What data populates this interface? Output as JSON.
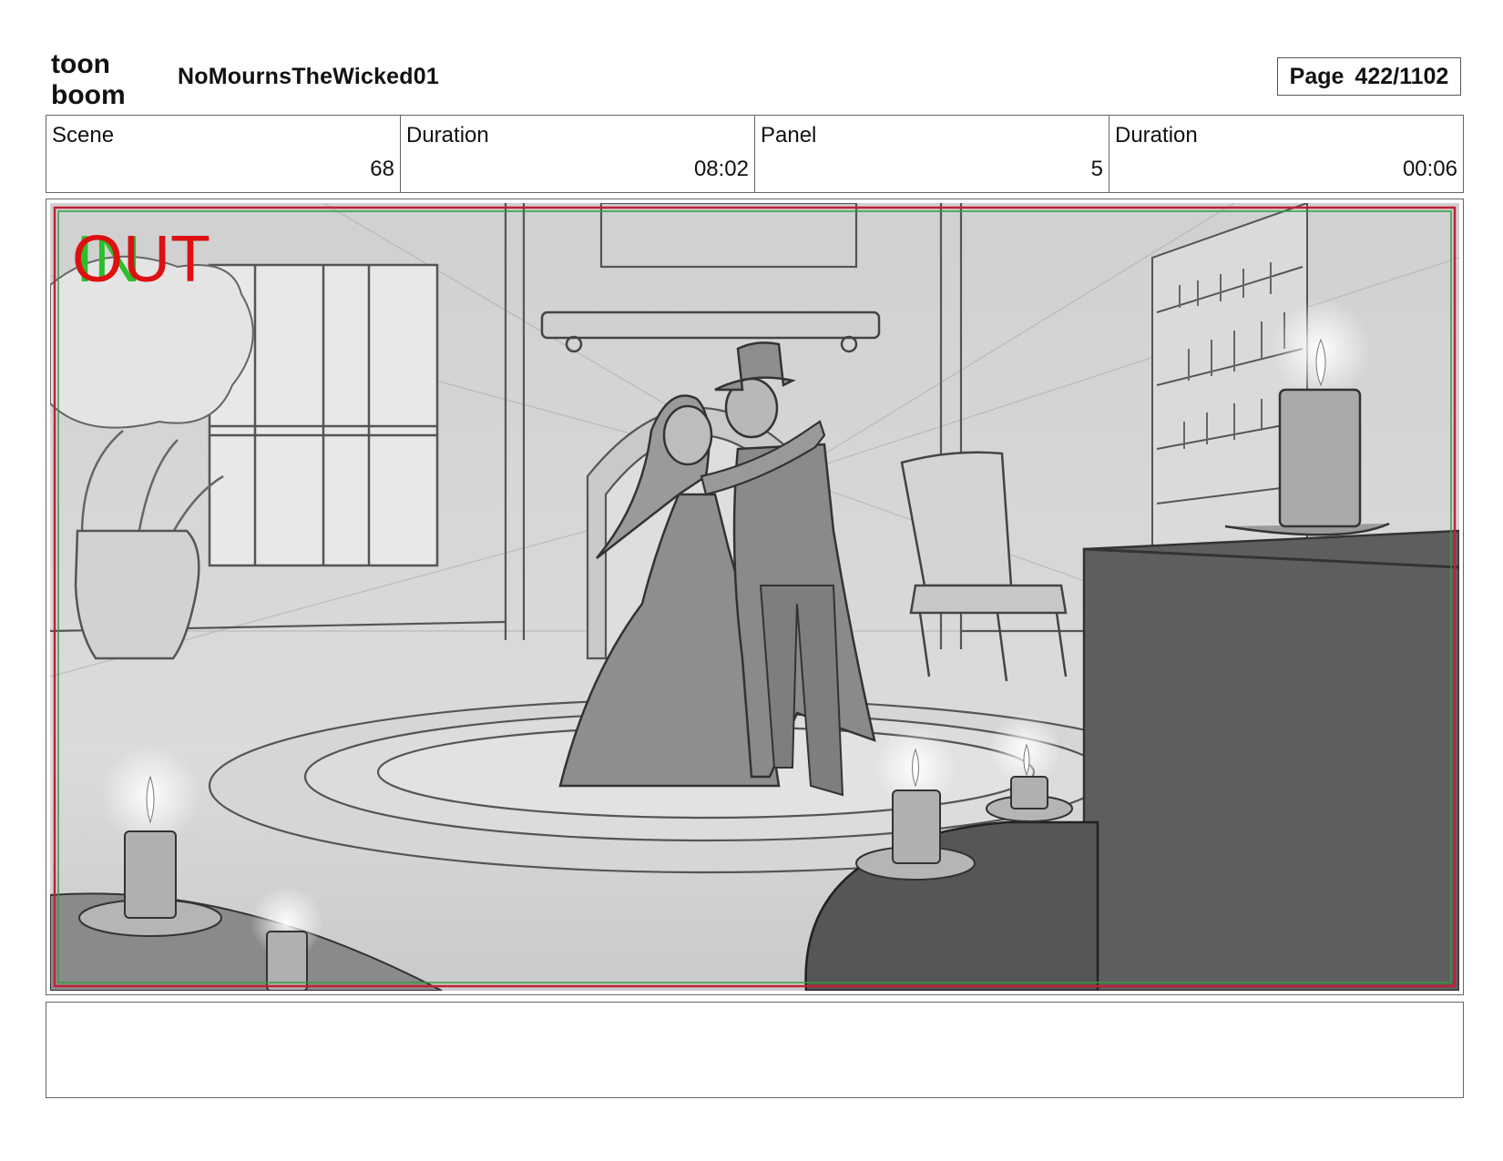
{
  "header": {
    "logo_text_top": "toon",
    "logo_text_bottom": "boom",
    "project_title": "NoMournsTheWicked01",
    "page_label": "Page",
    "page_number": "422/1102"
  },
  "info": {
    "scene_label": "Scene",
    "scene_value": "68",
    "scene_duration_label": "Duration",
    "scene_duration_value": "08:02",
    "panel_label": "Panel",
    "panel_value": "5",
    "panel_duration_label": "Duration",
    "panel_duration_value": "00:06"
  },
  "panel": {
    "marker_in": "IN",
    "marker_out": "OUT",
    "safe_frame_colors": [
      "#c0203a",
      "#2e9e3e"
    ]
  },
  "notes": {
    "text": ""
  }
}
